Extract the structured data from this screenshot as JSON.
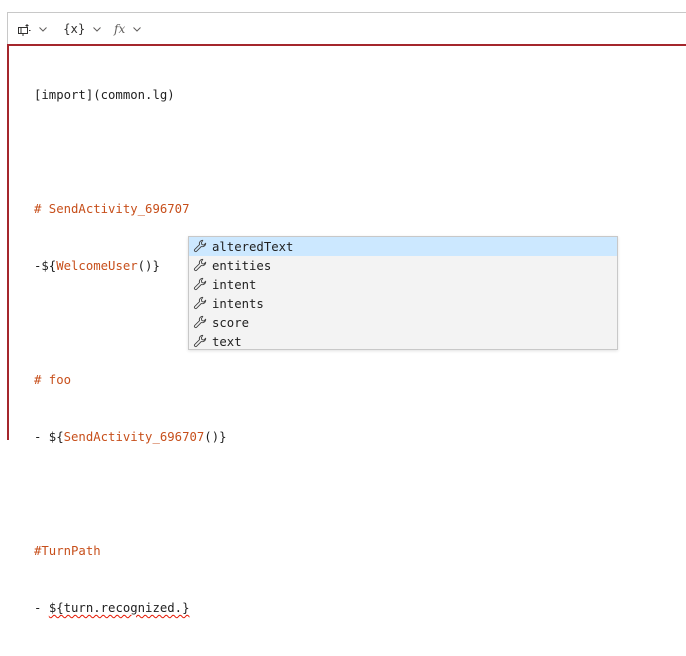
{
  "toolbar": {
    "items": [
      {
        "icon": "template-insert-icon",
        "label": ""
      },
      {
        "icon": "variable-icon",
        "label": "{x}"
      },
      {
        "icon": "function-icon",
        "label": "fx"
      }
    ]
  },
  "editor": {
    "lines": [
      {
        "text": "[import](common.lg)"
      },
      {
        "text": ""
      },
      {
        "text": "# SendActivity_696707"
      },
      {
        "prefix": "-${",
        "ref": "WelcomeUser",
        "suffix": "()}"
      },
      {
        "text": ""
      },
      {
        "text": "# foo"
      },
      {
        "prefix": "- ${",
        "ref": "SendActivity_696707",
        "suffix": "()}"
      },
      {
        "text": ""
      },
      {
        "text": "#TurnPath"
      },
      {
        "prefix": "- ",
        "squiggle": "${turn.recognized.}"
      }
    ]
  },
  "suggestions": {
    "icon": "wrench-icon",
    "selected_index": 0,
    "items": [
      "alteredText",
      "entities",
      "intent",
      "intents",
      "score",
      "text"
    ]
  },
  "colors": {
    "error_border": "#a4262c",
    "comment": "#c74f1b",
    "selection": "#cce8ff"
  }
}
